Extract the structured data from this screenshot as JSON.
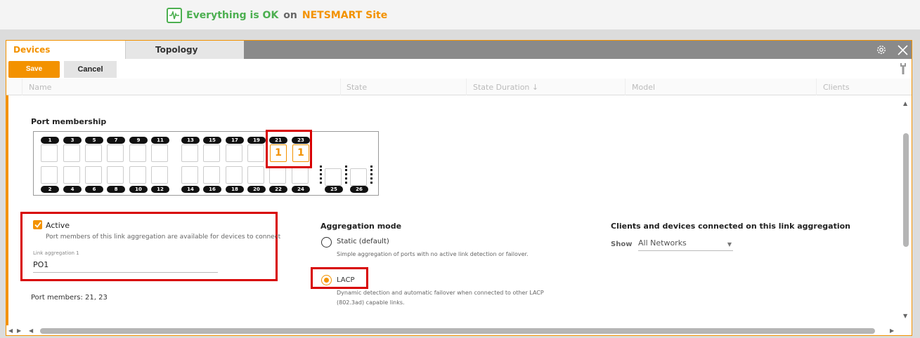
{
  "status": {
    "message": "Everything is OK",
    "on": "on",
    "site": "NETSMART Site",
    "icon": "health-pulse-icon",
    "ok_color": "#4caf50",
    "site_color": "#f39200"
  },
  "tabs": [
    {
      "label": "Devices",
      "active": true
    },
    {
      "label": "Topology",
      "active": false
    }
  ],
  "toolbar": {
    "save_label": "Save",
    "cancel_label": "Cancel",
    "accent": "#f39200"
  },
  "columns": [
    "Name",
    "State",
    "State Duration ↓",
    "Model",
    "Clients"
  ],
  "port_membership": {
    "title": "Port membership",
    "top_ports": [
      "1",
      "3",
      "5",
      "7",
      "9",
      "11",
      "13",
      "15",
      "17",
      "19",
      "21",
      "23"
    ],
    "bottom_ports": [
      "2",
      "4",
      "6",
      "8",
      "10",
      "12",
      "14",
      "16",
      "18",
      "20",
      "22",
      "24"
    ],
    "uplink_ports": [
      "25",
      "26"
    ],
    "member_port_21": "1",
    "member_port_23": "1"
  },
  "link_aggregation": {
    "active_label": "Active",
    "active_checked": true,
    "active_help": "Port members of this link aggregation are available for devices to connect",
    "field_label": "Link aggregation 1",
    "field_value": "PO1",
    "port_members": "Port members: 21, 23"
  },
  "aggregation_mode": {
    "title": "Aggregation mode",
    "static_label": "Static (default)",
    "static_help": "Simple aggregation of ports with no active link detection or failover.",
    "lacp_label": "LACP",
    "lacp_help_1": "Dynamic detection and automatic failover when connected to other LACP",
    "lacp_help_2": "(802.3ad) capable links.",
    "selected": "LACP"
  },
  "clients": {
    "title": "Clients and devices connected on this link aggregation",
    "show_label": "Show",
    "show_value": "All Networks"
  }
}
